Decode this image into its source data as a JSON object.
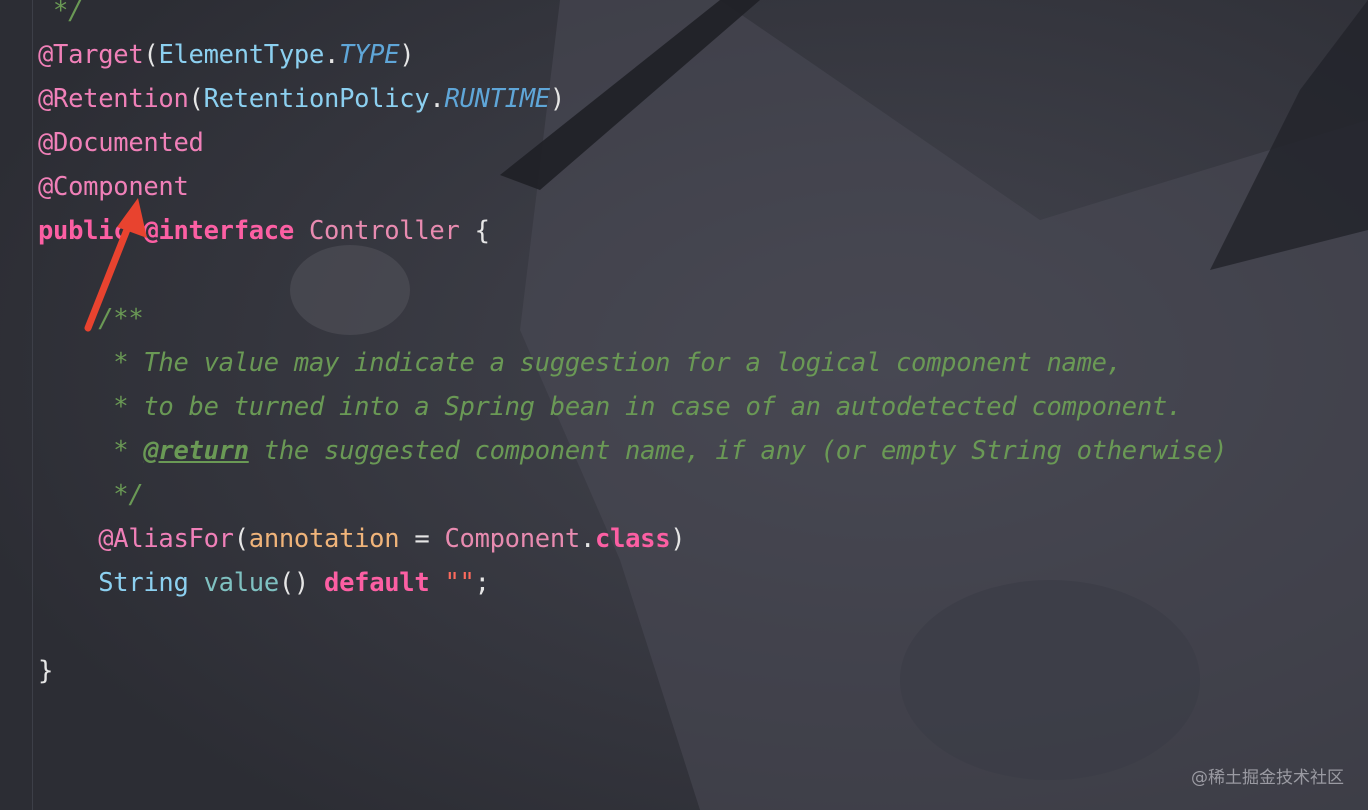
{
  "editor": {
    "lines": [
      {
        "id": "l0",
        "tokens": [
          {
            "c": "cmt",
            "t": " */"
          }
        ]
      },
      {
        "id": "l1",
        "tokens": [
          {
            "c": "ann",
            "t": "@Target"
          },
          {
            "c": "punc",
            "t": "("
          },
          {
            "c": "type",
            "t": "ElementType"
          },
          {
            "c": "punc",
            "t": "."
          },
          {
            "c": "ital",
            "t": "TYPE"
          },
          {
            "c": "punc",
            "t": ")"
          }
        ]
      },
      {
        "id": "l2",
        "tokens": [
          {
            "c": "ann",
            "t": "@Retention"
          },
          {
            "c": "punc",
            "t": "("
          },
          {
            "c": "type",
            "t": "RetentionPolicy"
          },
          {
            "c": "punc",
            "t": "."
          },
          {
            "c": "ital",
            "t": "RUNTIME"
          },
          {
            "c": "punc",
            "t": ")"
          }
        ]
      },
      {
        "id": "l3",
        "tokens": [
          {
            "c": "ann",
            "t": "@Documented"
          }
        ]
      },
      {
        "id": "l4",
        "tokens": [
          {
            "c": "ann",
            "t": "@Component"
          }
        ]
      },
      {
        "id": "l5",
        "tokens": [
          {
            "c": "kw",
            "t": "public"
          },
          {
            "c": "plain",
            "t": " "
          },
          {
            "c": "kw",
            "t": "@interface"
          },
          {
            "c": "plain",
            "t": " "
          },
          {
            "c": "ident",
            "t": "Controller"
          },
          {
            "c": "plain",
            "t": " "
          },
          {
            "c": "punc",
            "t": "{"
          }
        ]
      },
      {
        "id": "l6",
        "tokens": []
      },
      {
        "id": "l7",
        "tokens": [
          {
            "c": "cmt",
            "t": "    /**"
          }
        ]
      },
      {
        "id": "l8",
        "tokens": [
          {
            "c": "cmt",
            "t": "     * The value may indicate a suggestion for a logical component name,"
          }
        ]
      },
      {
        "id": "l9",
        "tokens": [
          {
            "c": "cmt",
            "t": "     * to be turned into a Spring bean in case of an autodetected component."
          }
        ]
      },
      {
        "id": "l10",
        "tokens": [
          {
            "c": "cmt",
            "t": "     * "
          },
          {
            "c": "doctag",
            "t": "@return"
          },
          {
            "c": "cmt",
            "t": " the suggested component name, if any (or empty String otherwise)"
          }
        ]
      },
      {
        "id": "l11",
        "tokens": [
          {
            "c": "cmt",
            "t": "     */"
          }
        ]
      },
      {
        "id": "l12",
        "tokens": [
          {
            "c": "plain",
            "t": "    "
          },
          {
            "c": "ann",
            "t": "@AliasFor"
          },
          {
            "c": "punc",
            "t": "("
          },
          {
            "c": "param",
            "t": "annotation"
          },
          {
            "c": "punc",
            "t": " = "
          },
          {
            "c": "ident",
            "t": "Component"
          },
          {
            "c": "punc",
            "t": "."
          },
          {
            "c": "kw",
            "t": "class"
          },
          {
            "c": "punc",
            "t": ")"
          }
        ]
      },
      {
        "id": "l13",
        "tokens": [
          {
            "c": "plain",
            "t": "    "
          },
          {
            "c": "type",
            "t": "String"
          },
          {
            "c": "plain",
            "t": " "
          },
          {
            "c": "fn",
            "t": "value"
          },
          {
            "c": "punc",
            "t": "() "
          },
          {
            "c": "kw",
            "t": "default"
          },
          {
            "c": "plain",
            "t": " "
          },
          {
            "c": "str",
            "t": "\"\""
          },
          {
            "c": "punc",
            "t": ";"
          }
        ]
      },
      {
        "id": "l14",
        "tokens": []
      },
      {
        "id": "l15",
        "tokens": [
          {
            "c": "punc",
            "t": "}"
          }
        ]
      }
    ]
  },
  "annotation_arrow": {
    "color": "#e8432f",
    "points_to": "public"
  },
  "watermark": "@稀土掘金技术社区",
  "colors": {
    "background": "#2f3038",
    "keyword": "#fc5fa3",
    "comment": "#6a9955",
    "type": "#8cd0f0"
  }
}
